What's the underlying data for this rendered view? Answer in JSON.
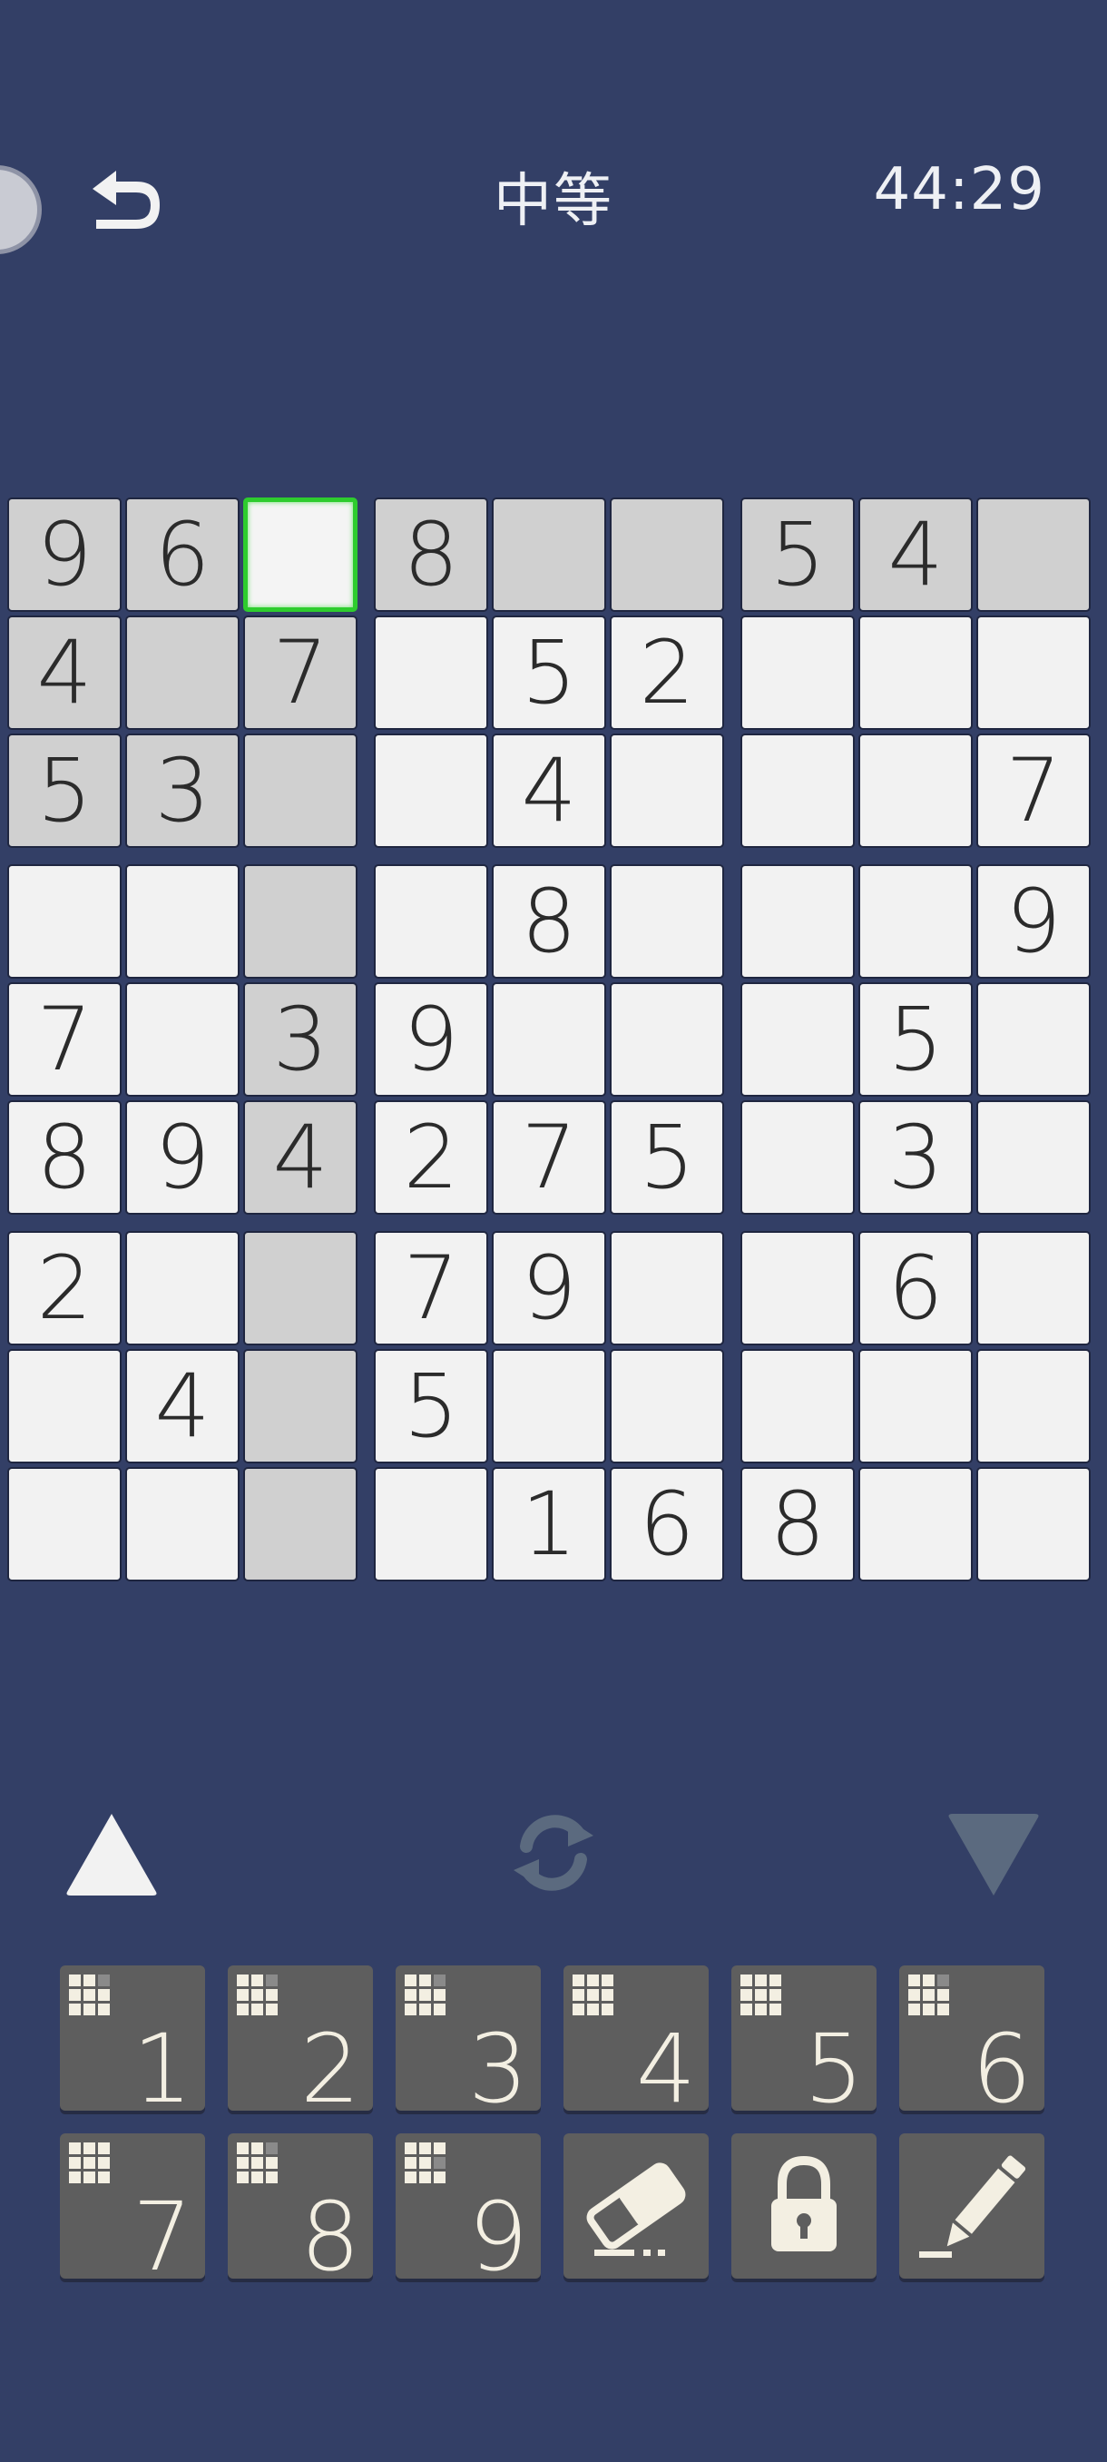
{
  "header": {
    "title": "中等",
    "timer": "44:29",
    "avatar_icon": "face-icon",
    "undo_icon": "undo-arrow-icon"
  },
  "board": {
    "size": 9,
    "selected": [
      0,
      2
    ],
    "values": [
      [
        "9",
        "6",
        "",
        "8",
        "",
        "",
        "5",
        "4",
        ""
      ],
      [
        "4",
        "",
        "7",
        "",
        "5",
        "2",
        "",
        "",
        ""
      ],
      [
        "5",
        "3",
        "",
        "",
        "4",
        "",
        "",
        "",
        "7"
      ],
      [
        "",
        "",
        "",
        "",
        "8",
        "",
        "",
        "",
        "9"
      ],
      [
        "7",
        "",
        "3",
        "9",
        "",
        "",
        "",
        "5",
        ""
      ],
      [
        "8",
        "9",
        "4",
        "2",
        "7",
        "5",
        "",
        "3",
        ""
      ],
      [
        "2",
        "",
        "",
        "7",
        "9",
        "",
        "",
        "6",
        ""
      ],
      [
        "",
        "4",
        "",
        "5",
        "",
        "",
        "",
        "",
        ""
      ],
      [
        "",
        "",
        "",
        "",
        "1",
        "6",
        "8",
        "",
        ""
      ]
    ],
    "colors": {
      "cell": "#f2f2f2",
      "highlight": "#d0d0d0",
      "selected_border": "#2ecc2e",
      "background": "#333f66"
    }
  },
  "controls": {
    "prev_icon": "triangle-up-icon",
    "refresh_icon": "refresh-icon",
    "next_icon": "triangle-down-icon"
  },
  "keypad": {
    "numbers": [
      "1",
      "2",
      "3",
      "4",
      "5",
      "6",
      "7",
      "8",
      "9"
    ],
    "remaining_pattern": [
      [
        1,
        1,
        0,
        1,
        1,
        1,
        1,
        1,
        1
      ],
      [
        1,
        1,
        0,
        1,
        1,
        1,
        1,
        1,
        1
      ],
      [
        1,
        1,
        0,
        1,
        1,
        1,
        1,
        1,
        1
      ],
      [
        1,
        1,
        1,
        1,
        1,
        1,
        1,
        1,
        1
      ],
      [
        1,
        1,
        1,
        1,
        1,
        1,
        1,
        1,
        1
      ],
      [
        1,
        1,
        0,
        1,
        1,
        1,
        1,
        1,
        1
      ],
      [
        1,
        1,
        1,
        1,
        1,
        1,
        1,
        1,
        1
      ],
      [
        1,
        1,
        0,
        1,
        1,
        1,
        1,
        1,
        1
      ],
      [
        1,
        1,
        1,
        1,
        1,
        0,
        1,
        1,
        1
      ]
    ],
    "tools": [
      "eraser-icon",
      "lock-icon",
      "pencil-icon"
    ]
  }
}
